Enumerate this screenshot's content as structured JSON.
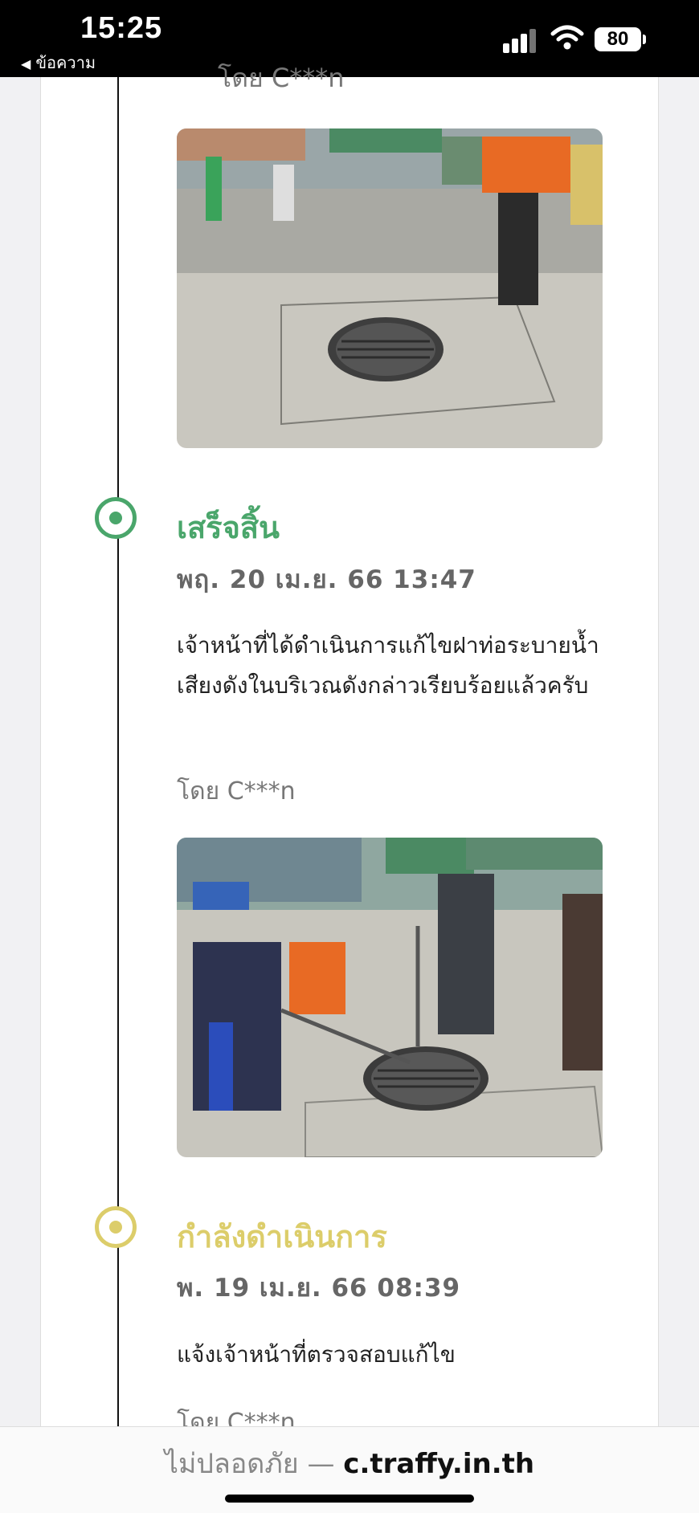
{
  "status_bar": {
    "time": "15:25",
    "back_label": "ข้อความ",
    "battery": "80",
    "icons": [
      "signal-icon",
      "wifi-icon",
      "battery-icon"
    ]
  },
  "timeline": {
    "partial_top_by": "โดย C***n",
    "entries": [
      {
        "status": "เสร็จสิ้น",
        "status_color": "#4aa66b",
        "date": "พฤ. 20 เม.ย. 66 13:47",
        "description": "เจ้าหน้าที่ได้ดำเนินการแก้ไขฝาท่อระบายน้ำเสียงดังในบริเวณดังกล่าวเรียบร้อยแล้วครับ",
        "by": "โดย C***n"
      },
      {
        "status": "กำลังดำเนินการ",
        "status_color": "#dccd6a",
        "date": "พ. 19 เม.ย. 66 08:39",
        "description": "แจ้งเจ้าหน้าที่ตรวจสอบแก้ไข",
        "by": "โดย C***n"
      }
    ]
  },
  "browser": {
    "unsafe_label": "ไม่ปลอดภัย",
    "separator": "—",
    "domain": "c.traffy.in.th"
  }
}
